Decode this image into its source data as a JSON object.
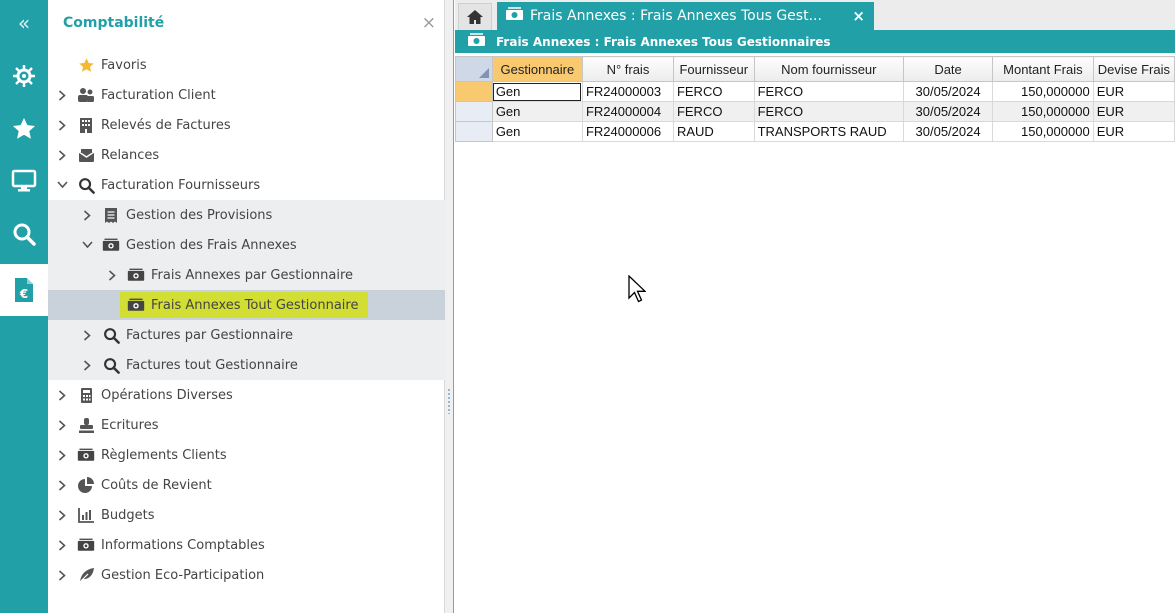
{
  "rail": {
    "collapse_icon": "double-chevron-left-icon",
    "items": [
      {
        "icon": "helm-icon"
      },
      {
        "icon": "star-icon"
      },
      {
        "icon": "monitor-icon"
      },
      {
        "icon": "search-icon"
      },
      {
        "icon": "euro-document-icon",
        "active": true
      }
    ]
  },
  "nav": {
    "title": "Comptabilité",
    "close": "×",
    "tree": [
      {
        "label": "Favoris",
        "icon": "star-icon",
        "expander": "none"
      },
      {
        "label": "Facturation Client",
        "icon": "users-icon",
        "expander": "collapsed"
      },
      {
        "label": "Relevés de Factures",
        "icon": "building-icon",
        "expander": "collapsed"
      },
      {
        "label": "Relances",
        "icon": "envelope-icon",
        "expander": "collapsed"
      },
      {
        "label": "Facturation Fournisseurs",
        "icon": "search-icon",
        "expander": "expanded"
      },
      {
        "label": "Gestion des Provisions",
        "icon": "receipt-icon",
        "expander": "collapsed"
      },
      {
        "label": "Gestion des Frais Annexes",
        "icon": "money-icon",
        "expander": "expanded"
      },
      {
        "label": "Frais Annexes par Gestionnaire",
        "icon": "money-icon",
        "expander": "collapsed"
      },
      {
        "label": "Frais Annexes Tout Gestionnaire",
        "icon": "money-icon",
        "expander": "none"
      },
      {
        "label": "Factures par Gestionnaire",
        "icon": "search-icon",
        "expander": "collapsed"
      },
      {
        "label": "Factures tout Gestionnaire",
        "icon": "search-icon",
        "expander": "collapsed"
      },
      {
        "label": "Opérations Diverses",
        "icon": "calculator-icon",
        "expander": "collapsed"
      },
      {
        "label": "Ecritures",
        "icon": "stamp-icon",
        "expander": "collapsed"
      },
      {
        "label": "Règlements Clients",
        "icon": "money-icon",
        "expander": "collapsed"
      },
      {
        "label": "Coûts de Revient",
        "icon": "pie-chart-icon",
        "expander": "collapsed"
      },
      {
        "label": "Budgets",
        "icon": "bar-chart-icon",
        "expander": "collapsed"
      },
      {
        "label": "Informations Comptables",
        "icon": "money-icon",
        "expander": "collapsed"
      },
      {
        "label": "Gestion Eco-Participation",
        "icon": "leaf-icon",
        "expander": "collapsed"
      }
    ]
  },
  "tabs": {
    "home_icon": "home-icon",
    "active_label": "Frais Annexes : Frais Annexes Tous Gest...",
    "close": "×"
  },
  "panel": {
    "title": "Frais Annexes : Frais Annexes Tous Gestionnaires"
  },
  "grid": {
    "columns": [
      "Gestionnaire",
      "N° frais",
      "Fournisseur",
      "Nom fournisseur",
      "Date",
      "Montant Frais",
      "Devise Frais"
    ],
    "rows": [
      [
        "Gen",
        "FR24000003",
        "FERCO",
        "FERCO",
        "30/05/2024",
        "150,000000",
        "EUR"
      ],
      [
        "Gen",
        "FR24000004",
        "FERCO",
        "FERCO",
        "30/05/2024",
        "150,000000",
        "EUR"
      ],
      [
        "Gen",
        "FR24000006",
        "RAUD",
        "TRANSPORTS RAUD",
        "30/05/2024",
        "150,000000",
        "EUR"
      ]
    ]
  },
  "colors": {
    "accent": "#21a0a8",
    "selected_highlight": "#d3de35",
    "sorted_header": "#f9c96f"
  }
}
